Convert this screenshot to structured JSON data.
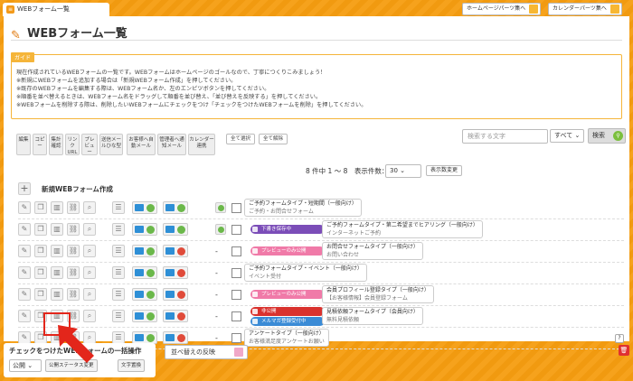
{
  "tab": {
    "title": "WEBフォーム一覧"
  },
  "topbar": {
    "btn1": "ホームページパーツ集へ",
    "btn2": "カレンダーパーツ集へ"
  },
  "page": {
    "title": "WEBフォーム一覧"
  },
  "guide": {
    "tag": "ガイド",
    "lines": [
      "現在作成されているWEBフォームの一覧です。WEBフォームはホームページのゴールなので、丁寧につくりこみましょう！",
      "※新規にWEBフォームを追加する場合は「新規WEBフォーム作成」を押してください。",
      "※既存のWEBフォームを編集する際は、WEBフォーム名か、左のエンピツボタンを押してください。",
      "※順番を並べ替えるときは、WEBフォーム名をドラッグして順番を並び替え、「並び替えを反映する」を押してください。",
      "※WEBフォームを削除する際は、削除したいWEBフォームにチェックをつけ「チェックをつけたWEBフォームを削除」を押してください。"
    ]
  },
  "toolbar": {
    "edit": "編集",
    "copy": "コピー",
    "stats": "集計確認",
    "link": "リンクURL",
    "preview": "プレビュー",
    "bg": "送信メールひな型",
    "auto": "お客様へ自動メール",
    "admin": "管理者へ通知メール",
    "cal": "カレンダー連携",
    "select_all": "全て選択",
    "deselect_all": "全て解除"
  },
  "search": {
    "placeholder": "検索する文字",
    "scope": "すべて",
    "button": "検索"
  },
  "paging": {
    "count_text": "8 件中 1 ～ 8　表示件数：",
    "per_page": "30",
    "sort_btn": "表示数変更"
  },
  "new_form": {
    "label": "新規WEBフォーム作成"
  },
  "rows": [
    {
      "check": "green",
      "status": "",
      "title": "ご予約フォームタイプ・短期間（一般向け）",
      "sub": "ご予約・お問合せフォーム"
    },
    {
      "check": "green",
      "status": "下書き保存中",
      "title": "ご予約フォームタイプ・第二希望までヒアリング（一般向け）",
      "sub": "インターネットご予約"
    },
    {
      "check": "dash",
      "status": "プレビューのみ公開",
      "title": "お問合せフォームタイプ（一般向け）",
      "sub": "お問い合わせ"
    },
    {
      "check": "dash",
      "status": "",
      "title": "ご予約フォームタイプ・イベント（一般向け）",
      "sub": "イベント受付"
    },
    {
      "check": "dash",
      "status": "プレビューのみ公開",
      "title": "会員プロフィール登録タイプ（一般向け）",
      "sub": "【お客様情報】会員登録フォーム"
    },
    {
      "check": "dash",
      "status": "非公開",
      "status2": "メルマガ登録受付中",
      "title": "見積依頼フォームタイプ（会員向け）",
      "sub": "無料見積依頼"
    },
    {
      "check": "dash",
      "status": "",
      "title": "アンケートタイプ（一般向け）",
      "sub": "お客様満足度アンケートお願い"
    }
  ],
  "bottom": {
    "title": "チェックをつけたWEBフォームの一括操作",
    "mode": "公開",
    "status_btn": "公開ステータス変更",
    "name_btn": "文字置換",
    "reorder": "並べ替えの反映"
  },
  "colors": {
    "accent": "#f39a1a",
    "purple": "#7b4db8",
    "pink": "#f07aa8",
    "red": "#d9322e",
    "blue": "#3a8bd6"
  }
}
